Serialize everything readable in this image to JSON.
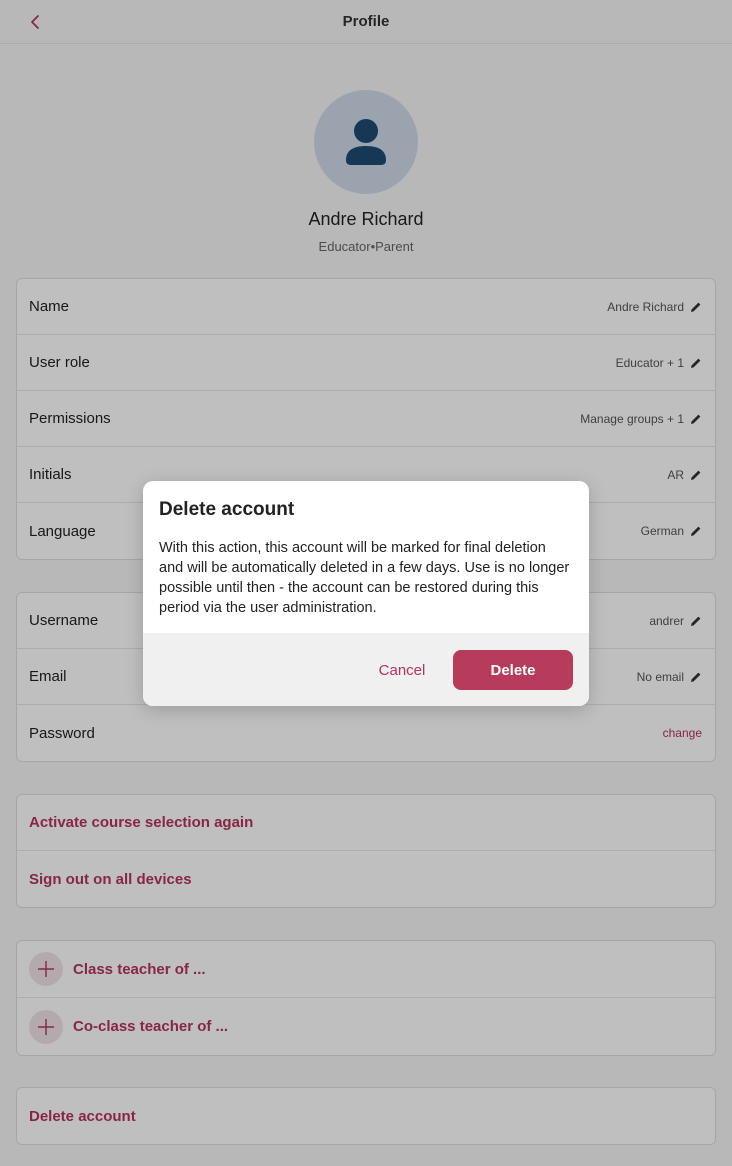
{
  "header": {
    "title": "Profile"
  },
  "profile": {
    "name": "Andre Richard",
    "roles": "Educator•Parent"
  },
  "card1": {
    "rows": [
      {
        "label": "Name",
        "value": "Andre Richard"
      },
      {
        "label": "User role",
        "value": "Educator + 1"
      },
      {
        "label": "Permissions",
        "value": "Manage groups + 1"
      },
      {
        "label": "Initials",
        "value": "AR"
      },
      {
        "label": "Language",
        "value": "German"
      }
    ]
  },
  "card2": {
    "rows": [
      {
        "label": "Username",
        "value": "andrer"
      },
      {
        "label": "Email",
        "value": "No email"
      },
      {
        "label": "Password",
        "value": "change"
      }
    ]
  },
  "actions": {
    "activate_course": "Activate course selection again",
    "sign_out_all": "Sign out on all devices"
  },
  "teachers": {
    "class_teacher": "Class teacher of ...",
    "co_class_teacher": "Co-class teacher of ..."
  },
  "delete_account_label": "Delete account",
  "modal": {
    "title": "Delete account",
    "body": "With this action, this account will be marked for final deletion and will be automatically deleted in a few days. Use is no longer possible until then - the account can be restored during this period via the user administration.",
    "cancel": "Cancel",
    "confirm": "Delete"
  },
  "colors": {
    "accent": "#b5345a",
    "delete_button": "#b73b5b",
    "avatar_bg": "#cfdbe8",
    "avatar_icon": "#1f4a75"
  },
  "icons": {
    "back": "chevron-left-icon",
    "edit": "pencil-icon",
    "add": "plus-icon",
    "avatar": "person-icon"
  }
}
